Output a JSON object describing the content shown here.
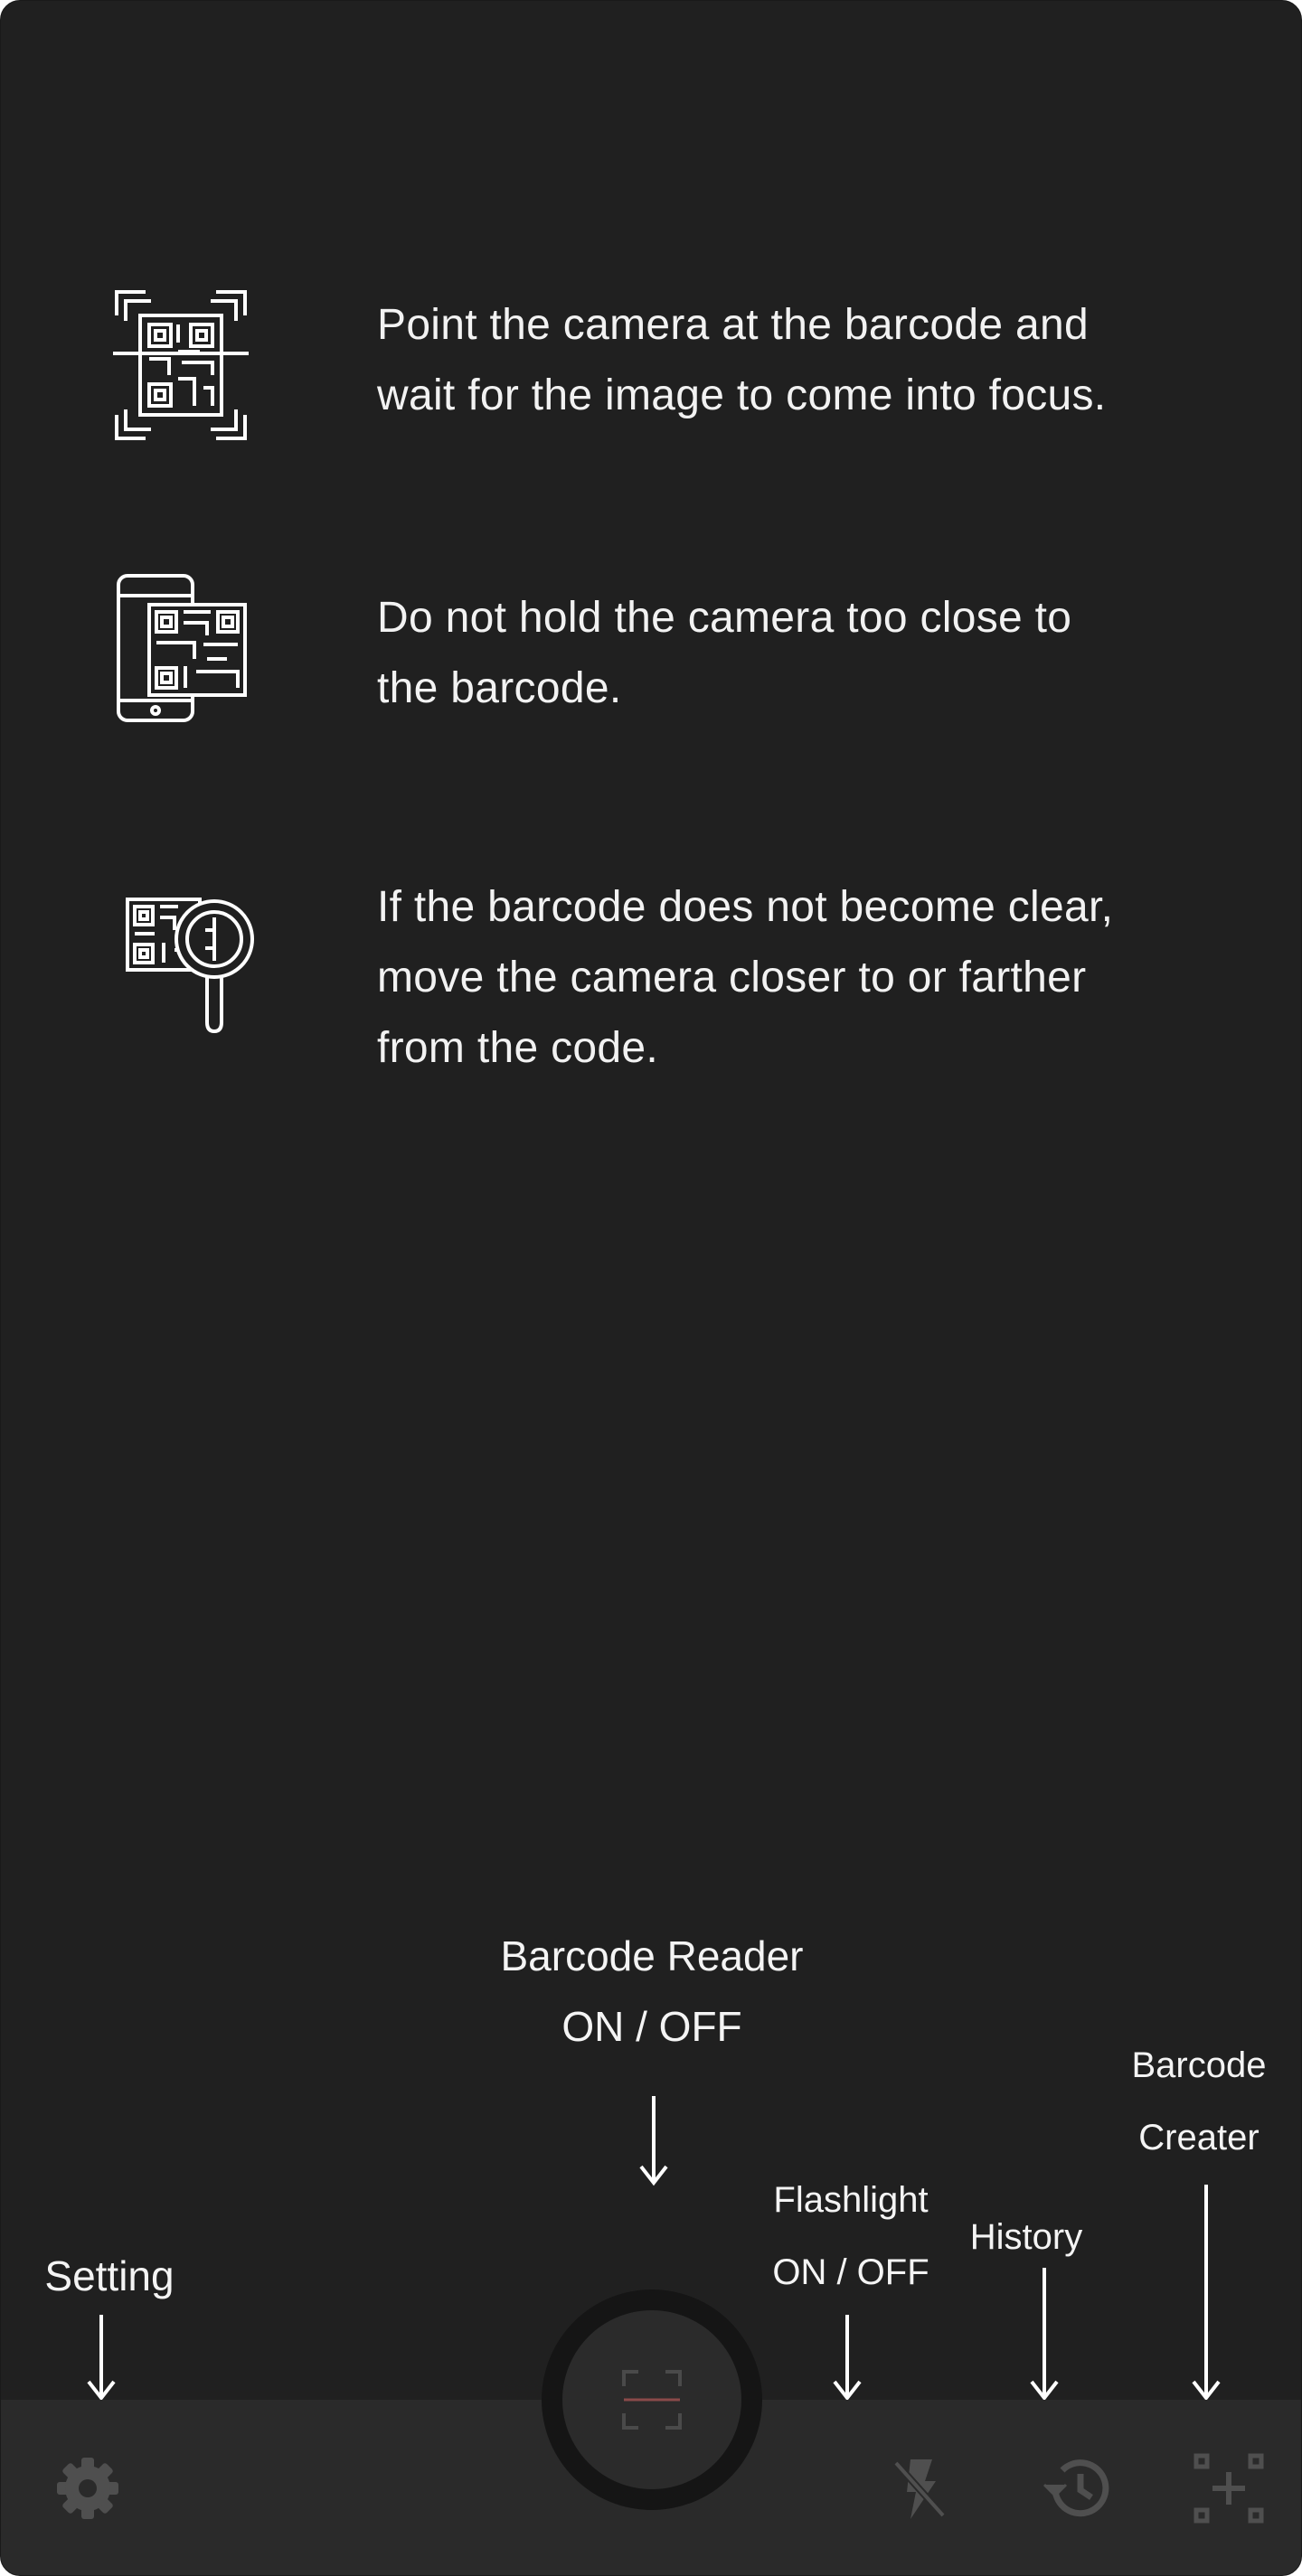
{
  "tips": [
    {
      "icon": "qr-scan-icon",
      "lines": [
        "Point the camera at the barcode and",
        "wait for the image to come into focus."
      ]
    },
    {
      "icon": "phone-qr-icon",
      "lines": [
        "Do not hold the camera too close to",
        "the barcode."
      ]
    },
    {
      "icon": "qr-magnifier-icon",
      "lines": [
        "If the barcode does not become clear,",
        "move the camera closer to or farther",
        "from the code."
      ]
    }
  ],
  "annotations": {
    "barcode_reader": [
      "Barcode Reader",
      "ON / OFF"
    ],
    "setting": "Setting",
    "flashlight": [
      "Flashlight",
      "ON / OFF"
    ],
    "history": "History",
    "barcode_creater": [
      "Barcode",
      "Creater"
    ]
  },
  "nav": {
    "settings_icon": "gear-icon",
    "scan_icon": "scan-frame-icon",
    "flash_icon": "flash-off-icon",
    "history_icon": "history-icon",
    "create_icon": "qr-create-icon"
  },
  "colors": {
    "background": "#202020",
    "bottom_bar": "#2a2a2a",
    "text": "#f2f2f2",
    "icon_muted": "#555555",
    "scan_accent": "#8a4a4a"
  }
}
